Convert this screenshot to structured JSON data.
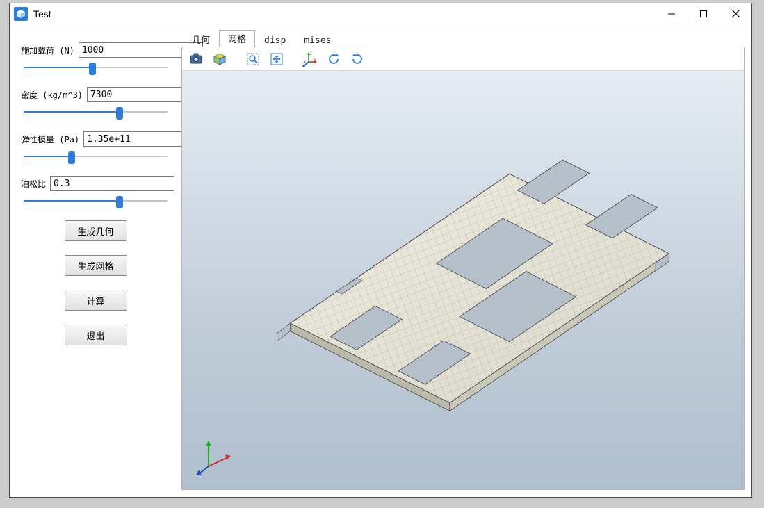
{
  "window": {
    "title": "Test"
  },
  "params": {
    "load": {
      "label": "施加载荷 (N)",
      "value": "1000",
      "slider_pct": 48
    },
    "density": {
      "label": "密度 (kg/m^3)",
      "value": "7300",
      "slider_pct": 66
    },
    "emod": {
      "label": "弹性模量 (Pa)",
      "value": "1.35e+11",
      "slider_pct": 34
    },
    "poisson": {
      "label": "泊松比",
      "value": "0.3",
      "slider_pct": 66
    }
  },
  "buttons": {
    "gen_geom": "生成几何",
    "gen_mesh": "生成网格",
    "compute": "计算",
    "exit": "退出"
  },
  "tabs": {
    "geom": "几何",
    "mesh": "网格",
    "disp": "disp",
    "mises": "mises",
    "active": "mesh"
  },
  "toolbar_icons": {
    "screenshot": "screenshot-icon",
    "view_cube": "viewcube-icon",
    "zoom_area": "zoom-area-icon",
    "pan": "pan-icon",
    "axis_triad": "axis-triad-icon",
    "rotate_ccw": "rotate-ccw-icon",
    "rotate_cw": "rotate-cw-icon"
  }
}
